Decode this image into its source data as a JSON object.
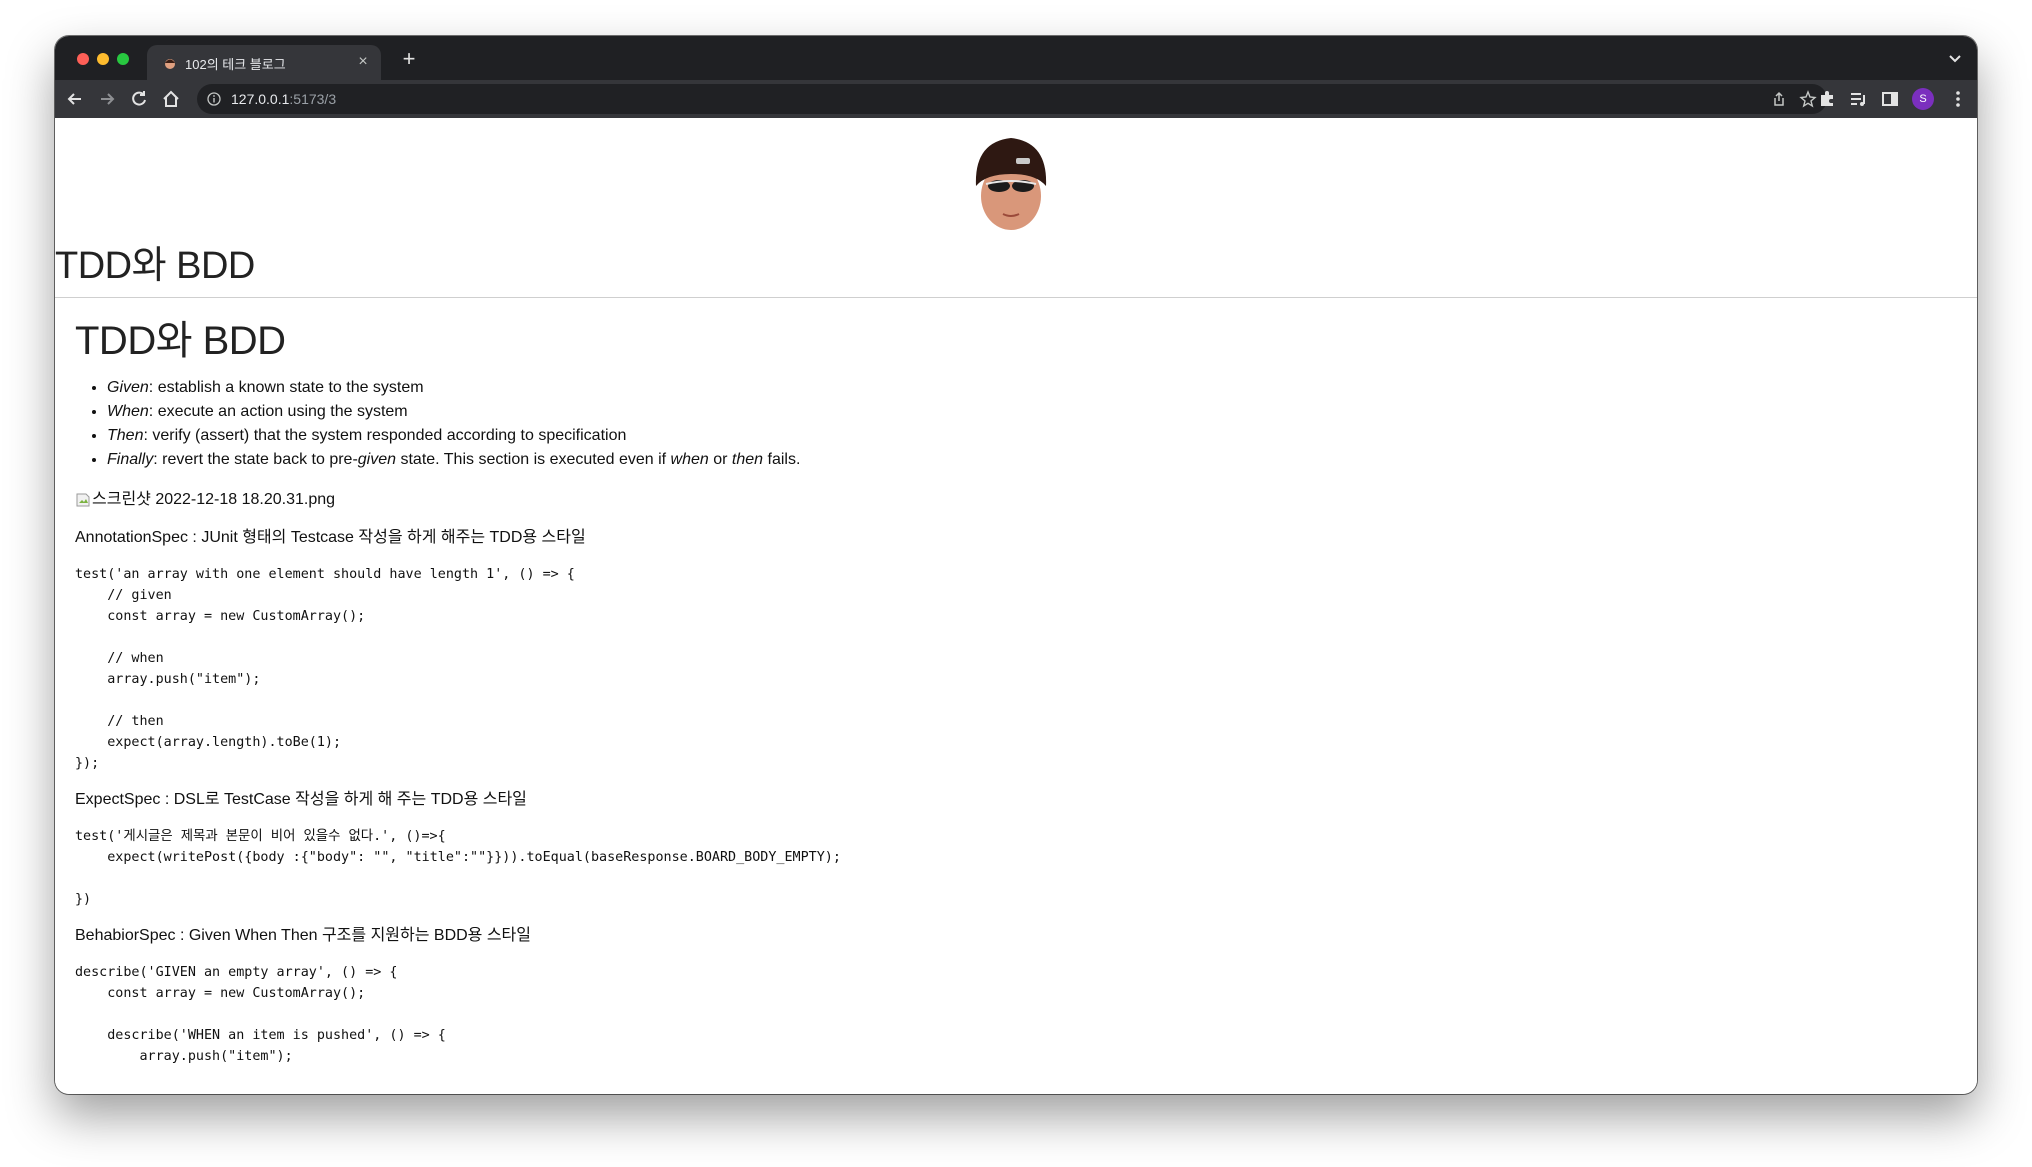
{
  "browser": {
    "tab_title": "102의 테크 블로그",
    "tab_close": "×",
    "new_tab": "+",
    "url_host": "127.0.0.1",
    "url_path": ":5173/3",
    "profile_initial": "S",
    "icons": [
      "back-icon",
      "forward-icon",
      "reload-icon",
      "home-icon",
      "site-info-icon",
      "share-icon",
      "star-icon",
      "extensions-icon",
      "reading-list-icon",
      "side-panel-icon",
      "menu-icon",
      "tab-search-icon"
    ]
  },
  "site": {
    "title": "TDD와 BDD"
  },
  "post": {
    "title": "TDD와 BDD",
    "list": [
      {
        "term": "Given",
        "text": ": establish a known state to the system"
      },
      {
        "term": "When",
        "text": ": execute an action using the system"
      },
      {
        "term": "Then",
        "text": ": verify (assert) that the system responded according to specification"
      },
      {
        "term": "Finally",
        "t1": ": revert the state back to pre-",
        "t2": "given",
        "t3": " state. This section is executed even if ",
        "t4": "when",
        "t5": " or ",
        "t6": "then",
        "t7": " fails."
      }
    ],
    "image_alt": "스크린샷 2022-12-18 18.20.31.png",
    "para1": "AnnotationSpec : JUnit 형태의 Testcase 작성을 하게 해주는 TDD용 스타일",
    "code1": [
      "test('an array with one element should have length 1', () => {",
      "    // given",
      "    const array = new CustomArray();",
      "",
      "    // when",
      "    array.push(\"item\");",
      "",
      "    // then",
      "    expect(array.length).toBe(1);",
      "});"
    ],
    "para2": "ExpectSpec : DSL로 TestCase 작성을 하게 해 주는 TDD용 스타일",
    "code2": [
      "test('게시글은 제목과 본문이 비어 있을수 없다.', ()=>{",
      "    expect(writePost({body :{\"body\": \"\", \"title\":\"\"}})).toEqual(baseResponse.BOARD_BODY_EMPTY);",
      "",
      "})"
    ],
    "para3": "BehabiorSpec : Given When Then 구조를 지원하는 BDD용 스타일",
    "code3": [
      "describe('GIVEN an empty array', () => {",
      "    const array = new CustomArray();",
      "",
      "    describe('WHEN an item is pushed', () => {",
      "        array.push(\"item\");"
    ]
  }
}
